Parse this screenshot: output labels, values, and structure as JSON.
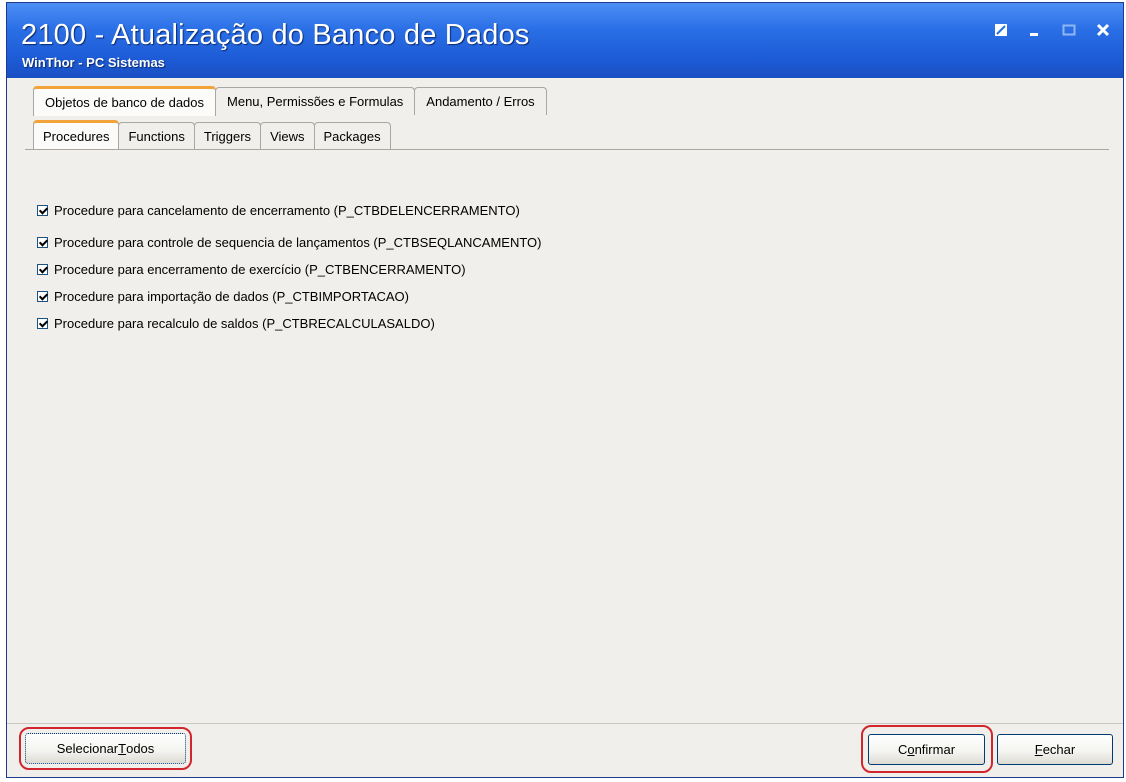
{
  "window": {
    "title": "2100 - Atualização do Banco de Dados",
    "subtitle": "WinThor - PC Sistemas",
    "controls": [
      "restore-icon",
      "minimize-icon",
      "maximize-icon",
      "close-icon"
    ]
  },
  "tabs_top": [
    {
      "label": "Objetos de banco de dados",
      "active": true
    },
    {
      "label": "Menu, Permissões e Formulas",
      "active": false
    },
    {
      "label": "Andamento / Erros",
      "active": false
    }
  ],
  "tabs_sub": [
    {
      "label": "Procedures",
      "active": true
    },
    {
      "label": "Functions",
      "active": false
    },
    {
      "label": "Triggers",
      "active": false
    },
    {
      "label": "Views",
      "active": false
    },
    {
      "label": "Packages",
      "active": false
    }
  ],
  "procedures": [
    {
      "label": "Procedure para cancelamento de encerramento (P_CTBDELENCERRAMENTO)",
      "checked": true
    },
    {
      "label": "Procedure para controle de sequencia de lançamentos (P_CTBSEQLANCAMENTO)",
      "checked": true
    },
    {
      "label": "Procedure para encerramento de exercício (P_CTBENCERRAMENTO)",
      "checked": true
    },
    {
      "label": "Procedure para importação de dados (P_CTBIMPORTACAO)",
      "checked": true
    },
    {
      "label": "Procedure para recalculo de saldos (P_CTBRECALCULASALDO)",
      "checked": true
    }
  ],
  "buttons": {
    "select_all_prefix": "Selecionar ",
    "select_all_mnemonic": "T",
    "select_all_rest": "odos",
    "confirm_prefix": "C",
    "confirm_mnemonic": "o",
    "confirm_rest": "nfirmar",
    "close_mnemonic": "F",
    "close_rest": "echar"
  },
  "colors": {
    "title_bar": "#2a6fe6",
    "active_tab_accent": "#f2a33a",
    "highlight": "#d2262f"
  }
}
